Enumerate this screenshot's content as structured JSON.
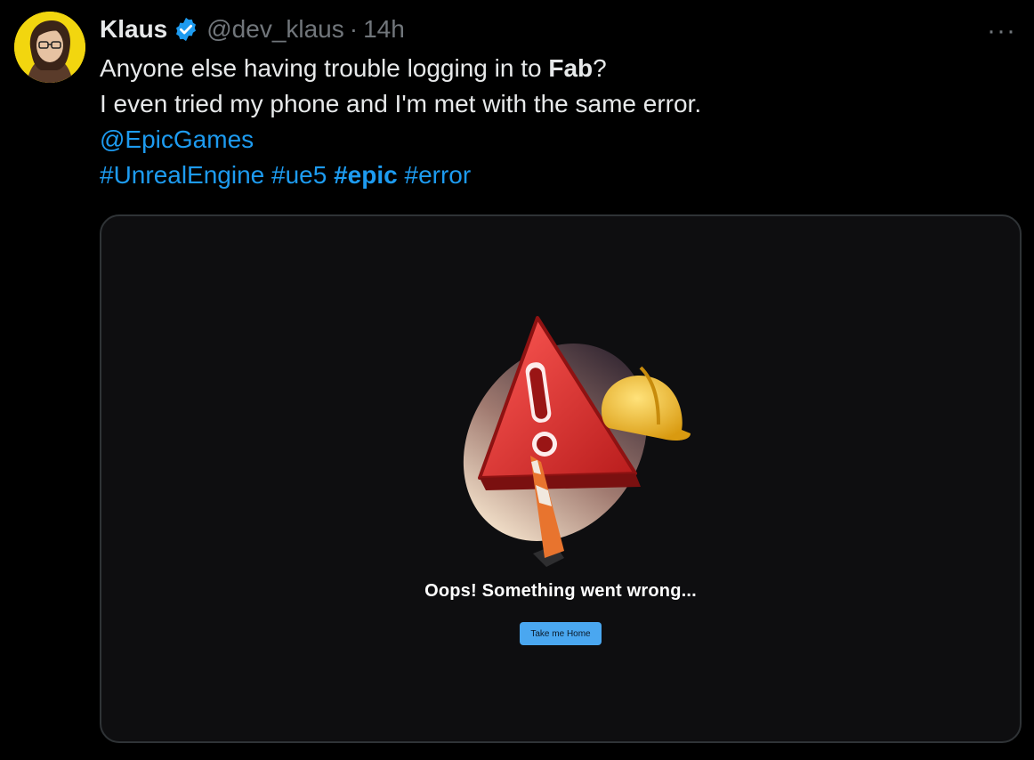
{
  "tweet": {
    "author": {
      "name": "Klaus",
      "handle": "@dev_klaus",
      "separator": "·",
      "time": "14h"
    },
    "more_icon": "more-icon",
    "text": {
      "line1_prefix": "Anyone else having trouble logging in to ",
      "line1_bold": "Fab",
      "line1_suffix": "?",
      "line2": "I even tried my phone and I'm met with the same error.",
      "mention": "@EpicGames",
      "hashtags": [
        "#UnrealEngine",
        "#ue5",
        "#epic",
        "#error"
      ]
    }
  },
  "media": {
    "error_title": "Oops! Something went wrong...",
    "button_label": "Take me Home"
  },
  "colors": {
    "background": "#000000",
    "link": "#1d9bf0",
    "verified": "#1d9bf0",
    "avatar_bg": "#f2d60f",
    "button": "#4aa7f0"
  }
}
